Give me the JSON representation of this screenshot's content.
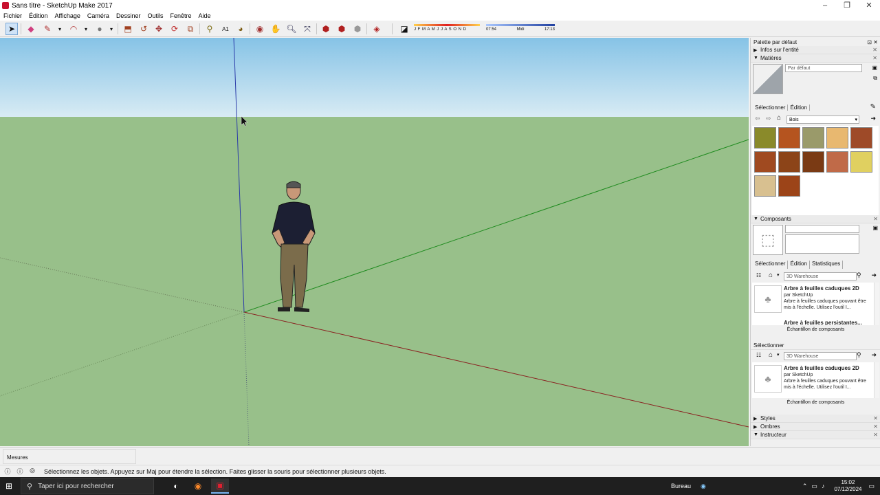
{
  "window": {
    "title": "Sans titre - SketchUp Make 2017"
  },
  "menu": [
    "Fichier",
    "Édition",
    "Affichage",
    "Caméra",
    "Dessiner",
    "Outils",
    "Fenêtre",
    "Aide"
  ],
  "shadow_bar": {
    "months": "J F M A M J J A S O N D",
    "time_start": "07:54",
    "time_mid": "Midi",
    "time_end": "17:13"
  },
  "panel": {
    "title": "Palette par défaut",
    "entity_info": "Infos sur l'entité",
    "materials": {
      "header": "Matières",
      "current": "Par défaut",
      "tab_select": "Sélectionner",
      "tab_edit": "Édition",
      "library": "Bois",
      "swatch_colors": [
        "#8a8a2a",
        "#b5541f",
        "#9a9a6a",
        "#e8b870",
        "#9e4a28",
        "#a04a20",
        "#8c4418",
        "#7a3a14",
        "#c06a48",
        "#e0d060",
        "#d8c090",
        "#9c4418"
      ]
    },
    "components": {
      "header": "Composants",
      "tab_select": "Sélectionner",
      "tab_edit": "Édition",
      "tab_stats": "Statistiques",
      "search": "3D Warehouse",
      "result_title": "Arbre à feuilles caduques 2D",
      "result_author": "par SketchUp",
      "result_desc": "Arbre à feuilles caduques pouvant être mis à l'échelle. Utilisez l'outil I...",
      "next_result": "Arbre à feuilles persistantes...",
      "sample": "Échantillon de composants"
    },
    "second_select": {
      "header": "Sélectionner",
      "search": "3D Warehouse",
      "result_title": "Arbre à feuilles caduques 2D",
      "result_author": "par SketchUp",
      "result_desc": "Arbre à feuilles caduques pouvant être mis à l'échelle. Utilisez l'outil I...",
      "sample": "Échantillon de composants"
    },
    "styles": "Styles",
    "shadows": "Ombres",
    "instructor": "Instructeur"
  },
  "measures": {
    "label": "Mesures"
  },
  "status": {
    "message": "Sélectionnez les objets. Appuyez sur Maj pour étendre la sélection. Faites glisser la souris pour sélectionner plusieurs objets."
  },
  "taskbar": {
    "search_placeholder": "Taper ici pour rechercher",
    "desktop": "Bureau",
    "time": "15:02",
    "date": "07/12/2024"
  }
}
